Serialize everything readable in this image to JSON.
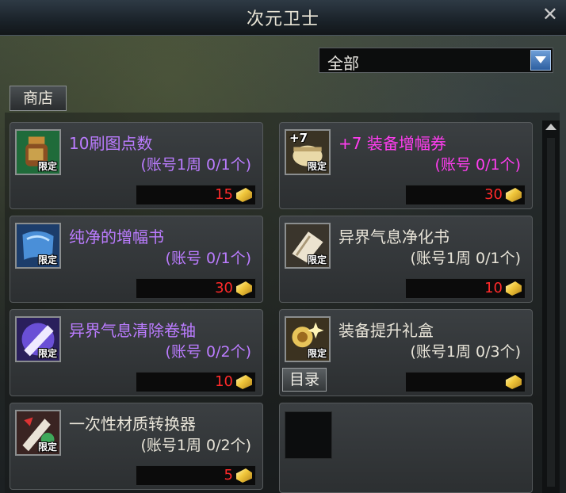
{
  "window": {
    "title": "次元卫士",
    "close_glyph": "✕"
  },
  "filter": {
    "selected": "全部"
  },
  "tabs": [
    {
      "label": "商店"
    }
  ],
  "catalog_button": "目录",
  "items": [
    {
      "name": "10刷图点数",
      "limit": "(账号1周 0/1个)",
      "price": "15",
      "tag": "限定",
      "name_color": "purple",
      "limit_color": "purple",
      "icon": "potion-icon"
    },
    {
      "name": "+7 装备增幅券",
      "limit": "(账号 0/1个)",
      "price": "30",
      "tag": "限定",
      "icon_badge": "+7",
      "name_color": "magenta",
      "limit_color": "magenta",
      "icon": "scroll-icon"
    },
    {
      "name": "纯净的增幅书",
      "limit": "(账号 0/1个)",
      "price": "30",
      "tag": "限定",
      "name_color": "purple",
      "limit_color": "purple",
      "icon": "book-icon"
    },
    {
      "name": "异界气息净化书",
      "limit": "(账号1周 0/1个)",
      "price": "10",
      "tag": "限定",
      "name_color": "white",
      "limit_color": "white",
      "icon": "purify-book-icon"
    },
    {
      "name": "异界气息清除卷轴",
      "limit": "(账号 0/2个)",
      "price": "10",
      "tag": "限定",
      "name_color": "purple",
      "limit_color": "purple",
      "icon": "clear-scroll-icon"
    },
    {
      "name": "装备提升礼盒",
      "limit": "(账号1周 0/3个)",
      "price": "",
      "tag": "限定",
      "name_color": "white",
      "limit_color": "white",
      "icon": "gift-box-icon"
    },
    {
      "name": "一次性材质转换器",
      "limit": "(账号1周 0/2个)",
      "price": "5",
      "tag": "限定",
      "name_color": "white",
      "limit_color": "white",
      "icon": "converter-icon"
    }
  ],
  "colors": {
    "price": "#ff2a2a",
    "purple": "#bb7cff",
    "magenta": "#ff3df0",
    "white": "#e8e4d8"
  }
}
